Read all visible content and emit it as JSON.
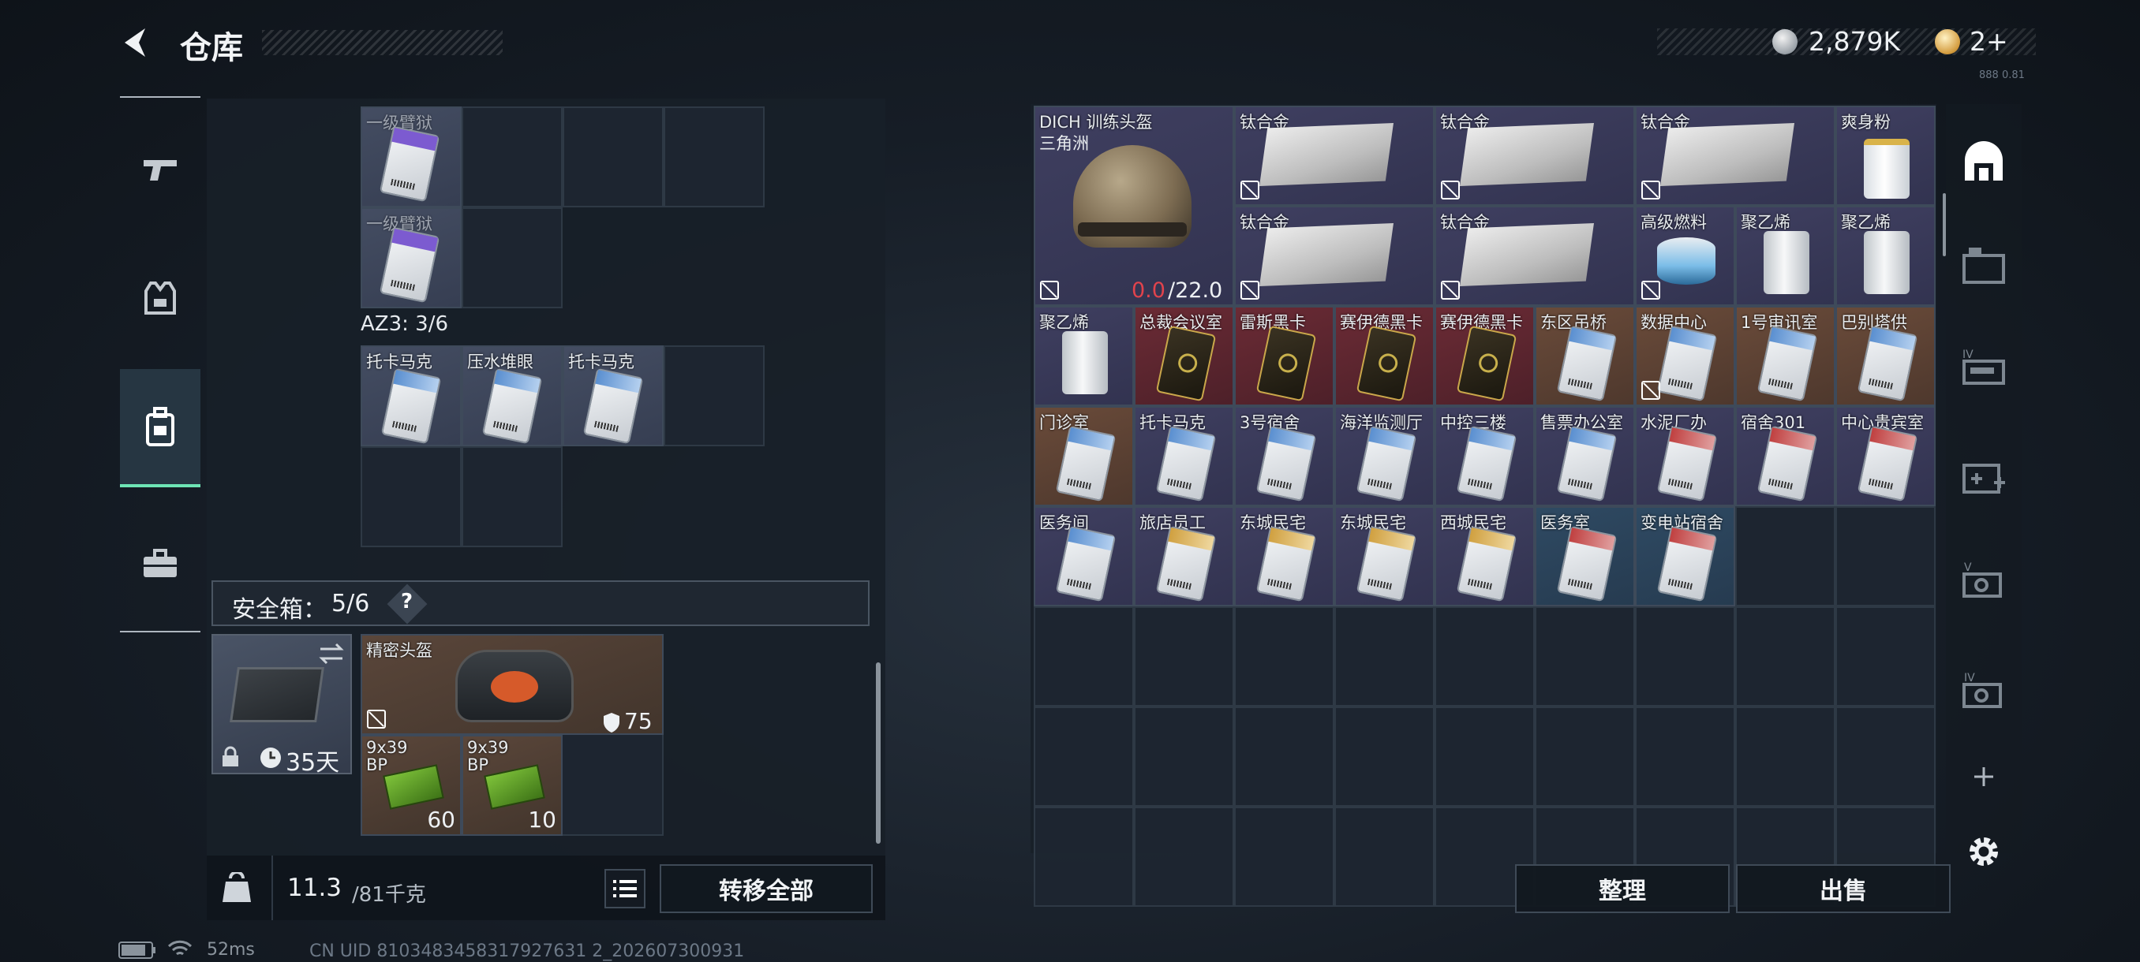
{
  "header": {
    "title": "仓库",
    "currency_main": "2,879K",
    "currency_secondary": "2+",
    "version_tag": "888 0.81"
  },
  "left_nav": [
    "weapons",
    "armor",
    "backpack",
    "toolbox"
  ],
  "containers": {
    "pouch_items": [
      "一级臂狱",
      "一级臂狱"
    ],
    "az3_label": "AZ3: 3/6",
    "az3_items": [
      "托卡马克",
      "压水堆眼",
      "托卡马克"
    ],
    "safebox_label": "安全箱：",
    "safebox_count": "5/6",
    "safebox_help": "?",
    "safebox_timer": "35天",
    "safe_items": {
      "helmet_name": "精密头盔",
      "helmet_durability": "75",
      "ammo1_name": "9x39 BP",
      "ammo1_count": "60",
      "ammo2_name": "9x39 BP",
      "ammo2_count": "10"
    }
  },
  "weight": {
    "current": "11.3",
    "max": "/81千克"
  },
  "buttons": {
    "transfer_all": "转移全部",
    "organize": "整理",
    "sell": "出售"
  },
  "stash": {
    "helmet": {
      "name": "DICH 训练头盔",
      "subtitle": "三角洲",
      "durability_current": "0.0",
      "durability_max": "/22.0"
    },
    "row0": [
      "钛合金",
      "钛合金",
      "钛合金",
      "爽身粉"
    ],
    "row1": [
      "钛合金",
      "钛合金",
      "高级燃料",
      "聚乙烯",
      "聚乙烯"
    ],
    "row2": [
      "聚乙烯",
      "总裁会议室",
      "雷斯黑卡",
      "赛伊德黑卡",
      "赛伊德黑卡",
      "东区吊桥",
      "数据中心",
      "1号审讯室",
      "巴别塔供"
    ],
    "row3": [
      "门诊室",
      "托卡马克",
      "3号宿舍",
      "海洋监测厅",
      "中控三楼",
      "售票办公室",
      "水泥厂办",
      "宿舍301",
      "中心贵宾室"
    ],
    "row4": [
      "医务间",
      "旅店员工",
      "东城民宅",
      "东城民宅",
      "西城民宅",
      "医务室",
      "变电站宿舍"
    ]
  },
  "status": {
    "latency": "52ms",
    "uid": "CN UID 8103483458317927631 2_202607300931"
  },
  "colors": {
    "accent": "#6ee5b5",
    "durability_red": "#e0434c"
  }
}
